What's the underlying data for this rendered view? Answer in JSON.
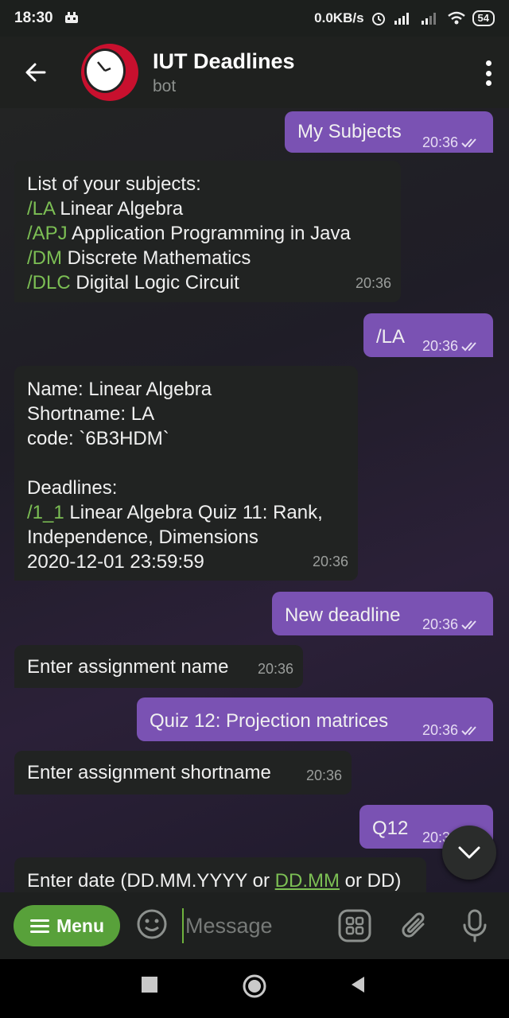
{
  "status_bar": {
    "time": "18:30",
    "speed": "0.0KB/s",
    "battery": "54"
  },
  "header": {
    "title": "IUT Deadlines",
    "subtitle": "bot"
  },
  "messages": [
    {
      "dir": "out",
      "text": "My Subjects",
      "time": "20:36"
    },
    {
      "dir": "in",
      "lines": [
        {
          "plain": "List of your subjects:"
        },
        {
          "cmd": "/LA",
          "plain": " Linear Algebra"
        },
        {
          "cmd": "/APJ",
          "plain": " Application Programming in Java"
        },
        {
          "cmd": "/DM",
          "plain": " Discrete Mathematics"
        },
        {
          "cmd": "/DLC",
          "plain": " Digital Logic Circuit"
        }
      ],
      "time": "20:36"
    },
    {
      "dir": "out",
      "text": "/LA",
      "time": "20:36"
    },
    {
      "dir": "in",
      "lines": [
        {
          "plain": "Name: Linear Algebra"
        },
        {
          "plain": "Shortname: LA"
        },
        {
          "plain": "code: `6B3HDM`"
        },
        {
          "plain": ""
        },
        {
          "plain": "Deadlines:"
        },
        {
          "cmd": "/1_1",
          "plain": " Linear Algebra Quiz 11: Rank,"
        },
        {
          "plain": "Independence, Dimensions"
        },
        {
          "plain": "2020-12-01 23:59:59"
        }
      ],
      "time": "20:36"
    },
    {
      "dir": "out",
      "text": "New deadline",
      "time": "20:36"
    },
    {
      "dir": "in",
      "text": "Enter assignment name",
      "time": "20:36"
    },
    {
      "dir": "out",
      "text": "Quiz 12: Projection matrices",
      "time": "20:36"
    },
    {
      "dir": "in",
      "text": "Enter assignment shortname",
      "time": "20:36"
    },
    {
      "dir": "out",
      "text": "Q12",
      "time": "20:36"
    },
    {
      "dir": "in",
      "pre": "Enter date (DD.MM.YYYY or ",
      "link": "DD.MM",
      "post": " or DD)"
    }
  ],
  "input_bar": {
    "menu_label": "Menu",
    "placeholder": "Message"
  },
  "colors": {
    "outgoing_bubble": "#7a52b3",
    "incoming_bubble": "#212322",
    "command_green": "#7cbf54",
    "menu_button": "#58a13a"
  },
  "icons": [
    "back-arrow-icon",
    "more-vert-icon",
    "scroll-down-icon",
    "menu-icon",
    "emoji-icon",
    "keyboard-grid-icon",
    "attach-icon",
    "mic-icon",
    "nav-square-icon",
    "nav-circle-icon",
    "nav-back-icon"
  ]
}
